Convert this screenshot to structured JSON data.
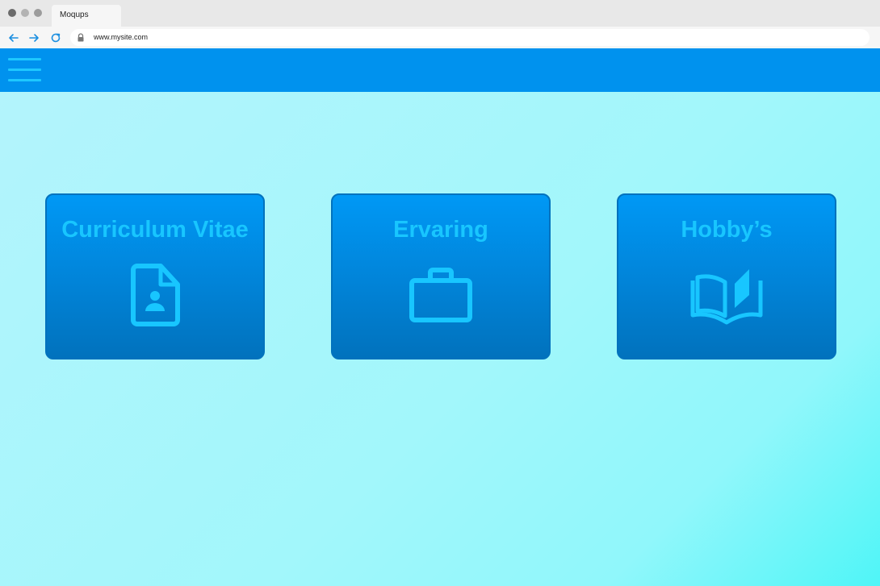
{
  "browser": {
    "tab_title": "Moqups",
    "url": "www.mysite.com"
  },
  "header": {
    "menu_icon": "hamburger-menu-icon"
  },
  "cards": [
    {
      "title": "Curriculum Vitae",
      "icon": "contact-file-icon"
    },
    {
      "title": "Ervaring",
      "icon": "briefcase-icon"
    },
    {
      "title": "Hobby’s",
      "icon": "open-book-icon"
    }
  ],
  "colors": {
    "header": "#0092ee",
    "card_top": "#0098f5",
    "card_bottom": "#0172bd",
    "accent": "#18c6ff",
    "background": "#a2f7fb"
  }
}
